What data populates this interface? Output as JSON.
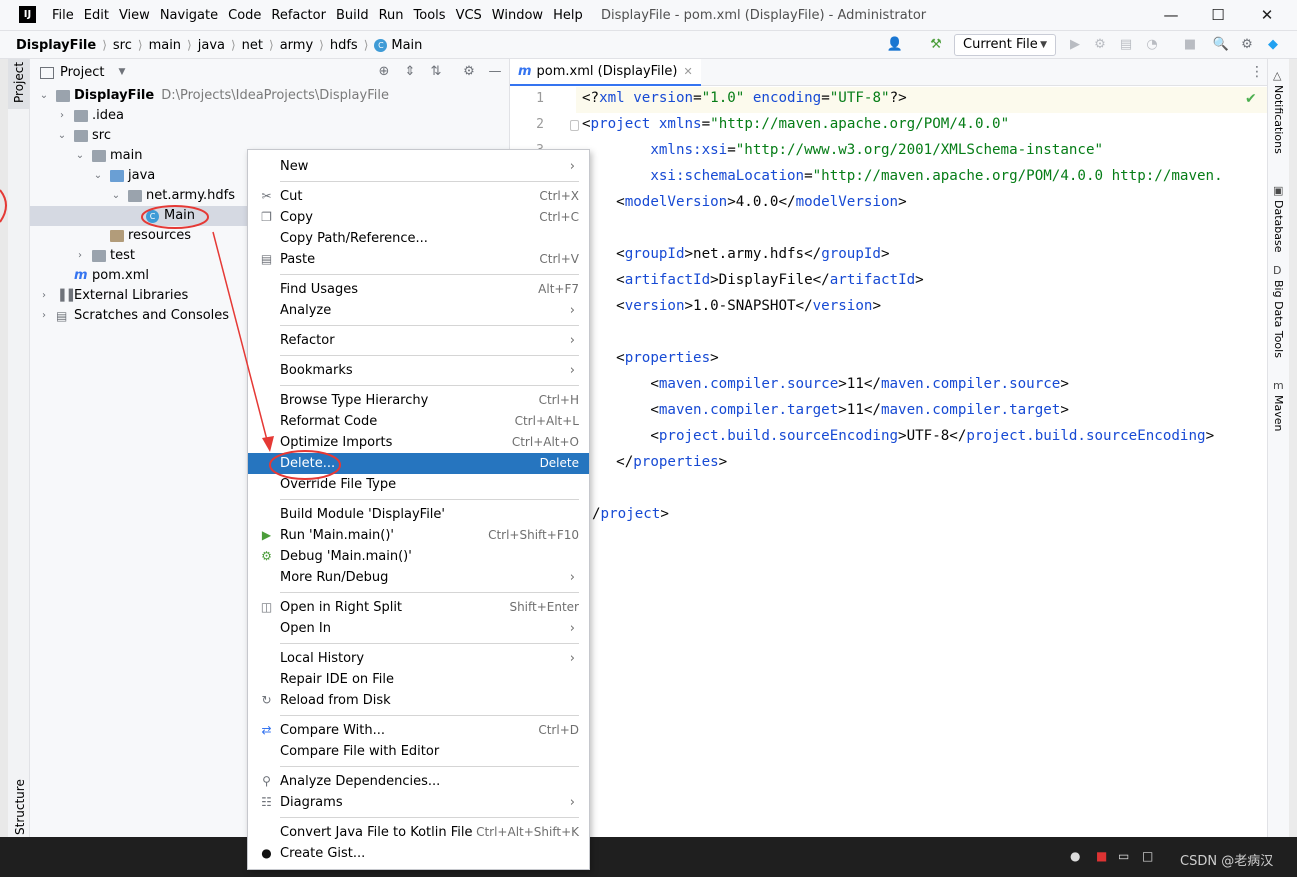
{
  "titlebar": {
    "logo": "IJ",
    "menus": [
      "File",
      "Edit",
      "View",
      "Navigate",
      "Code",
      "Refactor",
      "Build",
      "Run",
      "Tools",
      "VCS",
      "Window",
      "Help"
    ],
    "window_title": "DisplayFile - pom.xml (DisplayFile) - Administrator",
    "minimize": "—",
    "maximize": "☐",
    "close": "✕"
  },
  "navbar": {
    "breadcrumb": [
      "DisplayFile",
      "src",
      "main",
      "java",
      "net",
      "army",
      "hdfs",
      "Main"
    ],
    "run_config": "Current File"
  },
  "left_strip": {
    "project": "Project",
    "structure": "Structure"
  },
  "project_panel": {
    "title": "Project",
    "tree": [
      {
        "label": "DisplayFile",
        "path": "D:\\Projects\\IdeaProjects\\DisplayFile"
      },
      {
        "label": ".idea"
      },
      {
        "label": "src"
      },
      {
        "label": "main"
      },
      {
        "label": "java"
      },
      {
        "label": "net.army.hdfs"
      },
      {
        "label": "Main"
      },
      {
        "label": "resources"
      },
      {
        "label": "test"
      },
      {
        "label": "pom.xml"
      },
      {
        "label": "External Libraries"
      },
      {
        "label": "Scratches and Consoles"
      }
    ]
  },
  "editor": {
    "tab_label": "pom.xml (DisplayFile)",
    "line_numbers": [
      "1",
      "2",
      "3"
    ],
    "lines": [
      {
        "parts": [
          [
            "txt",
            "<?"
          ],
          [
            "tag",
            "xml "
          ],
          [
            "attr",
            "version"
          ],
          [
            "txt",
            "="
          ],
          [
            "str",
            "\"1.0\""
          ],
          [
            "txt",
            " "
          ],
          [
            "attr",
            "encoding"
          ],
          [
            "txt",
            "="
          ],
          [
            "str",
            "\"UTF-8\""
          ],
          [
            "txt",
            "?>"
          ]
        ]
      },
      {
        "parts": [
          [
            "txt",
            "<"
          ],
          [
            "tag",
            "project "
          ],
          [
            "attr",
            "xmlns"
          ],
          [
            "txt",
            "="
          ],
          [
            "str",
            "\"http://maven.apache.org/POM/4.0.0\""
          ]
        ]
      },
      {
        "parts": [
          [
            "txt",
            "        "
          ],
          [
            "attr",
            "xmlns:xsi"
          ],
          [
            "txt",
            "="
          ],
          [
            "str",
            "\"http://www.w3.org/2001/XMLSchema-instance\""
          ]
        ]
      },
      {
        "parts": [
          [
            "txt",
            "        "
          ],
          [
            "attr",
            "xsi:schemaLocation"
          ],
          [
            "txt",
            "="
          ],
          [
            "str",
            "\"http://maven.apache.org/POM/4.0.0 http://maven."
          ]
        ]
      },
      {
        "parts": [
          [
            "txt",
            "    <"
          ],
          [
            "tag",
            "modelVersion"
          ],
          [
            "txt",
            ">4.0.0</"
          ],
          [
            "tag",
            "modelVersion"
          ],
          [
            "txt",
            ">"
          ]
        ]
      },
      {
        "parts": []
      },
      {
        "parts": [
          [
            "txt",
            "    <"
          ],
          [
            "tag",
            "groupId"
          ],
          [
            "txt",
            ">net.army.hdfs</"
          ],
          [
            "tag",
            "groupId"
          ],
          [
            "txt",
            ">"
          ]
        ]
      },
      {
        "parts": [
          [
            "txt",
            "    <"
          ],
          [
            "tag",
            "artifactId"
          ],
          [
            "txt",
            ">DisplayFile</"
          ],
          [
            "tag",
            "artifactId"
          ],
          [
            "txt",
            ">"
          ]
        ]
      },
      {
        "parts": [
          [
            "txt",
            "    <"
          ],
          [
            "tag",
            "version"
          ],
          [
            "txt",
            ">1.0-SNAPSHOT</"
          ],
          [
            "tag",
            "version"
          ],
          [
            "txt",
            ">"
          ]
        ]
      },
      {
        "parts": []
      },
      {
        "parts": [
          [
            "txt",
            "    <"
          ],
          [
            "tag",
            "properties"
          ],
          [
            "txt",
            ">"
          ]
        ]
      },
      {
        "parts": [
          [
            "txt",
            "        <"
          ],
          [
            "tag",
            "maven.compiler.source"
          ],
          [
            "txt",
            ">11</"
          ],
          [
            "tag",
            "maven.compiler.source"
          ],
          [
            "txt",
            ">"
          ]
        ]
      },
      {
        "parts": [
          [
            "txt",
            "        <"
          ],
          [
            "tag",
            "maven.compiler.target"
          ],
          [
            "txt",
            ">11</"
          ],
          [
            "tag",
            "maven.compiler.target"
          ],
          [
            "txt",
            ">"
          ]
        ]
      },
      {
        "parts": [
          [
            "txt",
            "        <"
          ],
          [
            "tag",
            "project.build.sourceEncoding"
          ],
          [
            "txt",
            ">UTF-8</"
          ],
          [
            "tag",
            "project.build.sourceEncoding"
          ],
          [
            "txt",
            ">"
          ]
        ]
      },
      {
        "parts": [
          [
            "txt",
            "    </"
          ],
          [
            "tag",
            "properties"
          ],
          [
            "txt",
            ">"
          ]
        ]
      },
      {
        "parts": []
      },
      {
        "parts": [
          [
            "txt",
            "/"
          ],
          [
            "tag",
            "project"
          ],
          [
            "txt",
            ">"
          ]
        ]
      }
    ]
  },
  "right_strip": [
    "Notifications",
    "Database",
    "Big Data Tools",
    "Maven"
  ],
  "context_menu": {
    "items": [
      {
        "label": "New",
        "submenu": true
      },
      {
        "sep": true
      },
      {
        "label": "Cut",
        "shortcut": "Ctrl+X",
        "icon": "scissors-icon"
      },
      {
        "label": "Copy",
        "shortcut": "Ctrl+C",
        "icon": "copy-icon"
      },
      {
        "label": "Copy Path/Reference..."
      },
      {
        "label": "Paste",
        "shortcut": "Ctrl+V",
        "icon": "paste-icon"
      },
      {
        "sep": true
      },
      {
        "label": "Find Usages",
        "shortcut": "Alt+F7"
      },
      {
        "label": "Analyze",
        "submenu": true
      },
      {
        "sep": true
      },
      {
        "label": "Refactor",
        "submenu": true
      },
      {
        "sep": true
      },
      {
        "label": "Bookmarks",
        "submenu": true
      },
      {
        "sep": true
      },
      {
        "label": "Browse Type Hierarchy",
        "shortcut": "Ctrl+H"
      },
      {
        "label": "Reformat Code",
        "shortcut": "Ctrl+Alt+L"
      },
      {
        "label": "Optimize Imports",
        "shortcut": "Ctrl+Alt+O"
      },
      {
        "label": "Delete...",
        "shortcut": "Delete",
        "highlight": true
      },
      {
        "label": "Override File Type"
      },
      {
        "sep": true
      },
      {
        "label": "Build Module 'DisplayFile'"
      },
      {
        "label": "Run 'Main.main()'",
        "shortcut": "Ctrl+Shift+F10",
        "icon": "run-icon"
      },
      {
        "label": "Debug 'Main.main()'",
        "icon": "debug-icon"
      },
      {
        "label": "More Run/Debug",
        "submenu": true
      },
      {
        "sep": true
      },
      {
        "label": "Open in Right Split",
        "shortcut": "Shift+Enter",
        "icon": "split-icon"
      },
      {
        "label": "Open In",
        "submenu": true
      },
      {
        "sep": true
      },
      {
        "label": "Local History",
        "submenu": true
      },
      {
        "label": "Repair IDE on File"
      },
      {
        "label": "Reload from Disk",
        "icon": "reload-icon"
      },
      {
        "sep": true
      },
      {
        "label": "Compare With...",
        "shortcut": "Ctrl+D",
        "icon": "compare-icon"
      },
      {
        "label": "Compare File with Editor"
      },
      {
        "sep": true
      },
      {
        "label": "Analyze Dependencies...",
        "icon": "dependencies-icon"
      },
      {
        "label": "Diagrams",
        "submenu": true,
        "icon": "diagram-icon"
      },
      {
        "sep": true
      },
      {
        "label": "Convert Java File to Kotlin File",
        "shortcut": "Ctrl+Alt+Shift+K"
      },
      {
        "label": "Create Gist...",
        "icon": "github-icon"
      }
    ]
  },
  "watermark": "CSDN @老病汉",
  "colors": {
    "selection_blue": "#2675bf",
    "annotation_red": "#e53935",
    "xml_tag": "#174ad4",
    "xml_string": "#067d17"
  }
}
